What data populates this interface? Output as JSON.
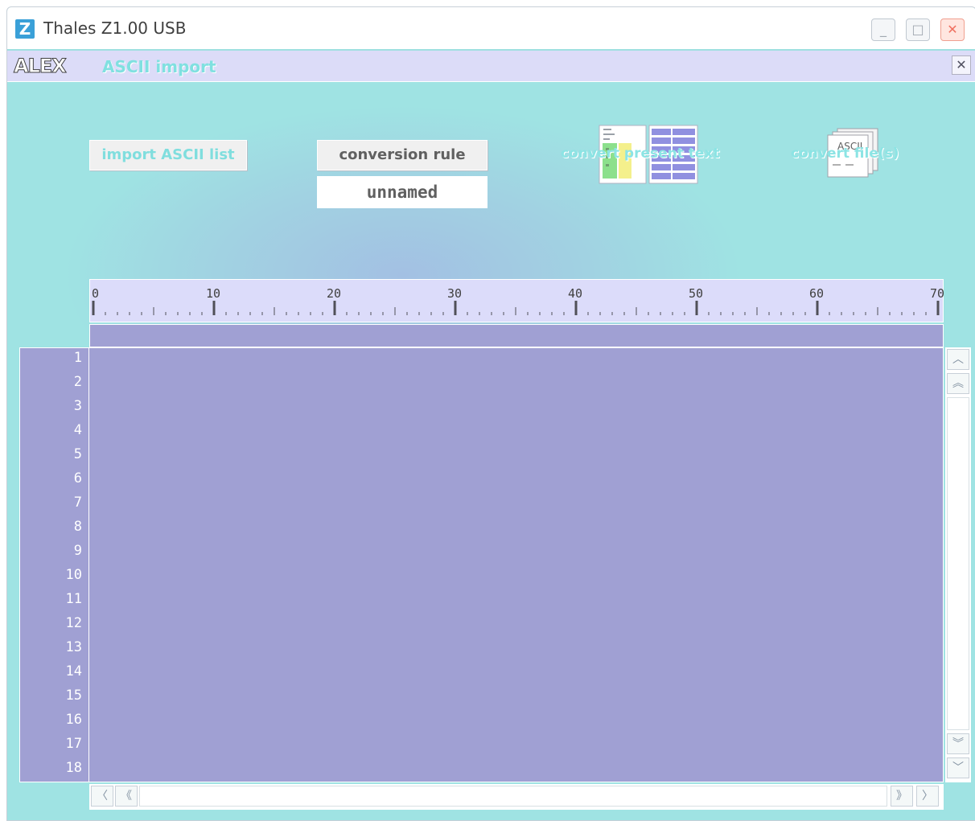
{
  "window": {
    "title": "Thales Z1.00 USB",
    "app_icon_glyph": "Z",
    "minimize_glyph": "_",
    "maximize_glyph": "□",
    "close_glyph": "✕"
  },
  "subbar": {
    "brand": "ALEX",
    "title": "ASCII import",
    "close_glyph": "✕"
  },
  "toolbar": {
    "import_label": "import ASCII list",
    "conversion_rule_label": "conversion rule",
    "rule_name": "unnamed",
    "convert_present_label": "convert present text",
    "convert_files_label": "convert file(s)",
    "convert_files_icon_text": "ASCII"
  },
  "ruler": {
    "labels": [
      "0",
      "10",
      "20",
      "30",
      "40",
      "50",
      "60",
      "70"
    ]
  },
  "editor": {
    "line_numbers": [
      "1",
      "2",
      "3",
      "4",
      "5",
      "6",
      "7",
      "8",
      "9",
      "10",
      "11",
      "12",
      "13",
      "14",
      "15",
      "16",
      "17",
      "18"
    ]
  },
  "scrollbars": {
    "up": "︿",
    "page_up": "︽",
    "page_down": "︾",
    "down": "﹀",
    "left": "〈",
    "page_left": "《",
    "page_right": "》",
    "right": "〉"
  },
  "colors": {
    "background": "#9fe0e0",
    "editor": "#a0a0d3",
    "ruler": "#dcdcfa",
    "accent_text": "#80e0e0"
  },
  "icons": [
    "z-app-icon",
    "minimize-icon",
    "maximize-icon",
    "close-icon",
    "convert-present-text-icon",
    "convert-files-icon"
  ]
}
